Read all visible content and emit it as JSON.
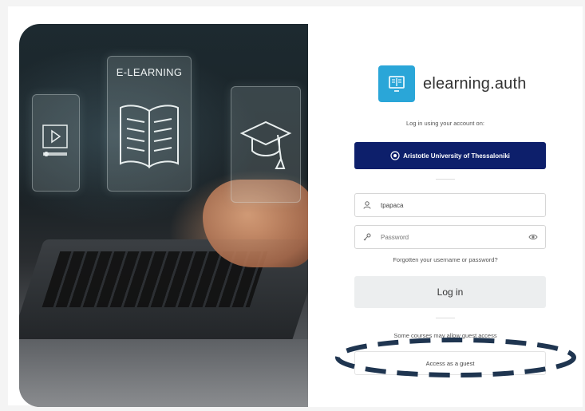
{
  "hero": {
    "book_card_title": "E-LEARNING"
  },
  "brand": {
    "name": "elearning.auth"
  },
  "login": {
    "subtitle": "Log in using your account on:",
    "idp_button_label": "Aristotle University of Thessaloniki",
    "username_value": "tpapaca",
    "password_placeholder": "Password",
    "forgot_link": "Forgotten your username or password?",
    "login_button_label": "Log in",
    "cookies_notice": "Some courses may allow guest access",
    "guest_button_label": "Access as a guest"
  },
  "colors": {
    "brand_logo": "#2aa6d8",
    "idp_button": "#0d1f6b",
    "annotation_stroke": "#1f3550"
  },
  "icons": [
    "play-icon",
    "book-icon",
    "graduation-cap-icon",
    "user-icon",
    "key-icon",
    "eye-icon",
    "university-seal-icon"
  ]
}
